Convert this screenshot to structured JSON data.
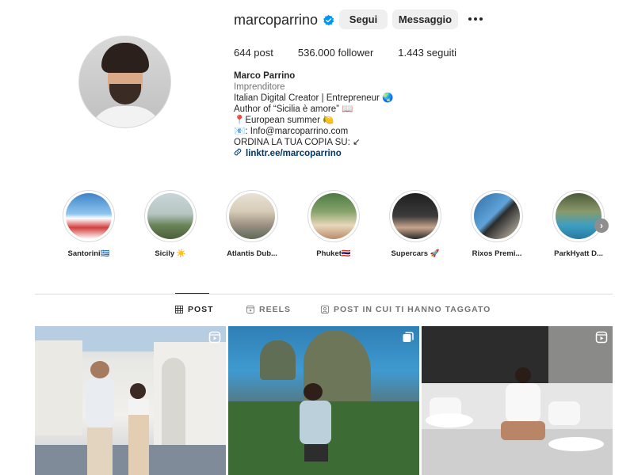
{
  "profile": {
    "username": "marcoparrino",
    "follow_label": "Segui",
    "message_label": "Messaggio",
    "stats": {
      "posts": "644 post",
      "followers": "536.000 follower",
      "following": "1.443 seguiti"
    },
    "bio": {
      "name": "Marco Parrino",
      "category": "Imprenditore",
      "lines": [
        "Italian Digital Creator | Entrepreneur 🌏",
        "Author of “Sicilia è amore” 📖",
        "📍European summer 🍋",
        "📧: Info@marcoparrino.com",
        "ORDINA LA TUA COPIA SU: ↙"
      ],
      "link": "linktr.ee/marcoparrino"
    }
  },
  "highlights": [
    {
      "label": "Santorini🇬🇷"
    },
    {
      "label": "Sicily ☀️"
    },
    {
      "label": "Atlantis Dub..."
    },
    {
      "label": "Phuket🇹🇭"
    },
    {
      "label": "Supercars 🚀"
    },
    {
      "label": "Rixos Premi..."
    },
    {
      "label": "ParkHyatt D..."
    }
  ],
  "tabs": {
    "post": "POST",
    "reels": "REELS",
    "tagged": "POST IN CUI TI HANNO TAGGATO"
  },
  "colors": {
    "verified": "#0095f6",
    "link": "#00376b",
    "button_bg": "#efefef",
    "secondary_text": "#737373"
  },
  "icons": {
    "verified": "verified-badge-icon",
    "more": "more-options-icon",
    "link": "link-chain-icon",
    "grid": "grid-icon",
    "reels": "reels-icon",
    "tagged": "tagged-icon",
    "post_type_reel": "reel-icon",
    "post_type_carousel": "carousel-icon"
  }
}
